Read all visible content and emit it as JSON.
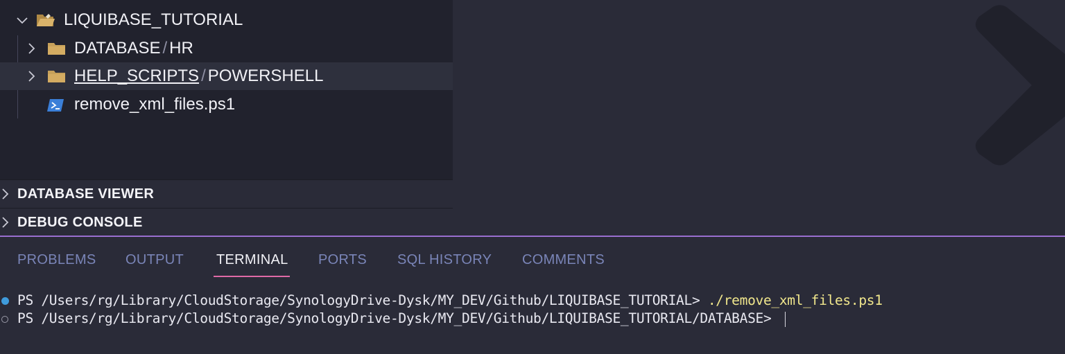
{
  "explorer": {
    "root": {
      "label": "LIQUIBASE_TUTORIAL"
    },
    "items": [
      {
        "label_a": "DATABASE",
        "separator": "/",
        "label_b": "HR"
      },
      {
        "label_a": "HELP_SCRIPTS",
        "separator": "/",
        "label_b": "POWERSHELL"
      },
      {
        "label": "remove_xml_files.ps1"
      }
    ]
  },
  "sections": [
    {
      "label": "DATABASE VIEWER"
    },
    {
      "label": "DEBUG CONSOLE"
    }
  ],
  "panel": {
    "tabs": [
      {
        "label": "PROBLEMS"
      },
      {
        "label": "OUTPUT"
      },
      {
        "label": "TERMINAL"
      },
      {
        "label": "PORTS"
      },
      {
        "label": "SQL HISTORY"
      },
      {
        "label": "COMMENTS"
      }
    ],
    "active_tab": "TERMINAL"
  },
  "terminal": {
    "lines": [
      {
        "prompt": "PS /Users/rg/Library/CloudStorage/SynologyDrive-Dysk/MY_DEV/Github/LIQUIBASE_TUTORIAL> ",
        "command": "./remove_xml_files.ps1"
      },
      {
        "prompt": "PS /Users/rg/Library/CloudStorage/SynologyDrive-Dysk/MY_DEV/Github/LIQUIBASE_TUTORIAL/DATABASE> ",
        "command": ""
      }
    ]
  },
  "colors": {
    "accent_border": "#9a6fd0",
    "tab_underline": "#e06aa6",
    "command_text": "#f0e68c",
    "folder": "#c7a15a"
  }
}
